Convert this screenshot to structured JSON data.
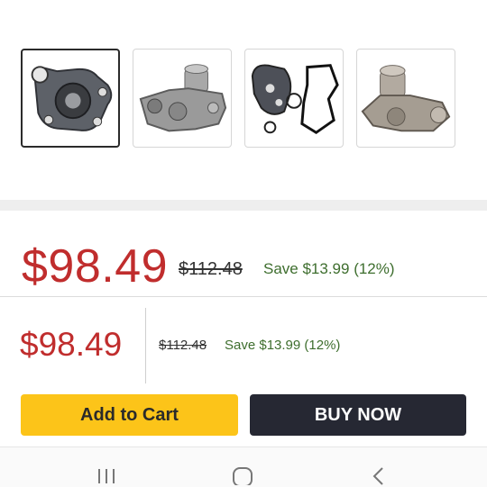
{
  "gallery": {
    "thumbnails": [
      {
        "label": "water-pump-front",
        "selected": true
      },
      {
        "label": "water-pump-side",
        "selected": false
      },
      {
        "label": "water-pump-gasket-kit",
        "selected": false
      },
      {
        "label": "water-pump-angle",
        "selected": false
      }
    ]
  },
  "pricing": {
    "price": "$98.49",
    "original_price": "$112.48",
    "savings": "Save $13.99 (12%)"
  },
  "sticky_bar": {
    "price": "$98.49",
    "original_price": "$112.48",
    "savings": "Save $13.99 (12%)",
    "add_to_cart_label": "Add to Cart",
    "buy_now_label": "BUY NOW"
  },
  "colors": {
    "price_red": "#c02d2d",
    "savings_green": "#3e6e2e",
    "cart_yellow": "#fcc419",
    "buy_dark": "#262833"
  },
  "system_nav": {
    "icons": [
      "recent-apps-icon",
      "home-icon",
      "back-icon"
    ]
  }
}
